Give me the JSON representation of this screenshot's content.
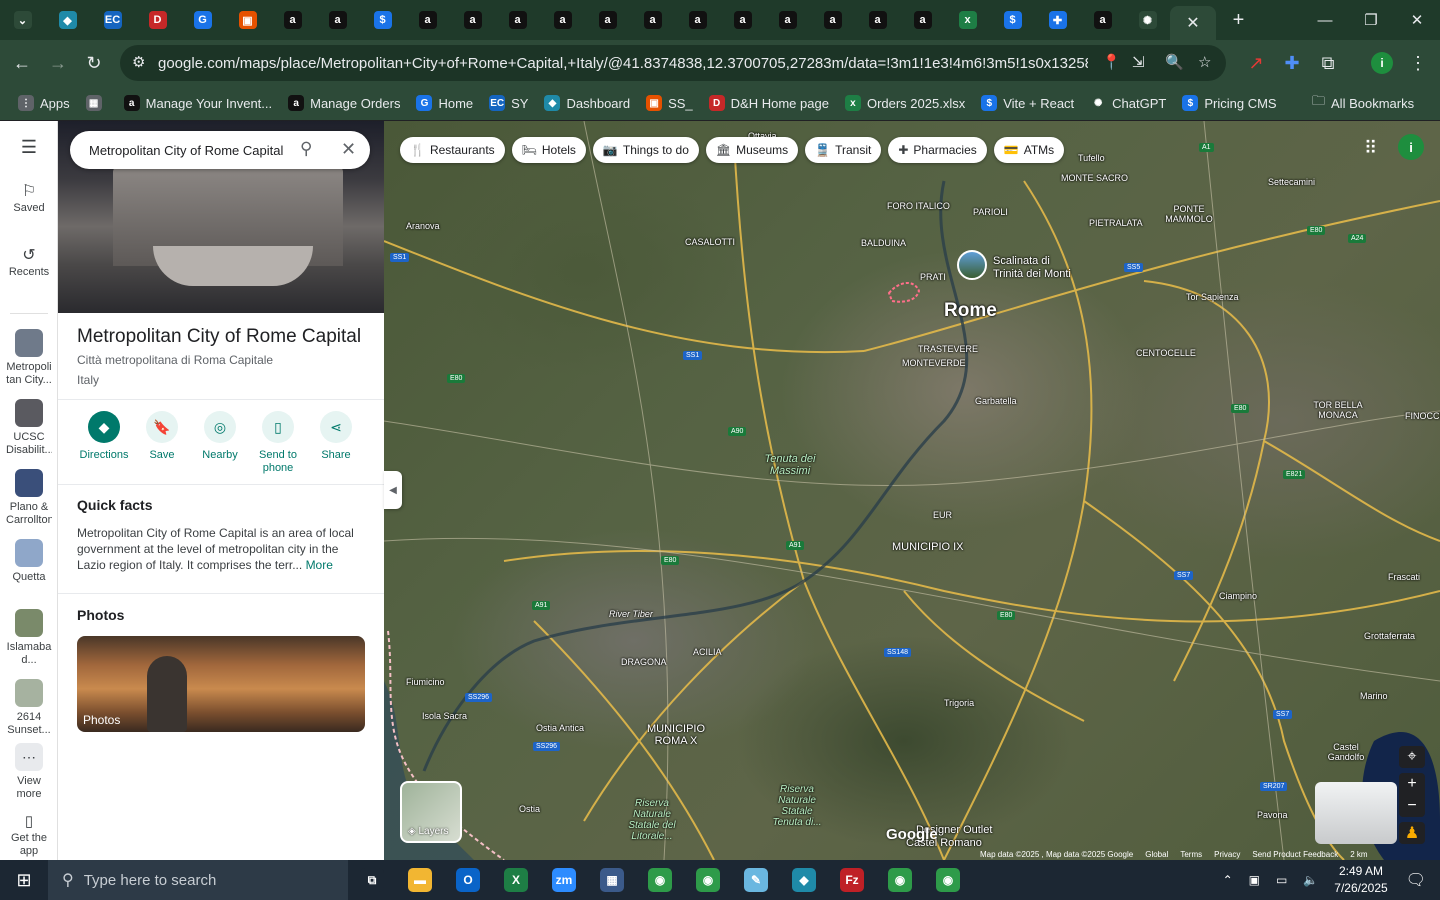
{
  "browser": {
    "tabs": [
      {
        "icon": "chevron-down-icon",
        "color": "#2d4a38",
        "glyph": "⌄"
      },
      {
        "icon": "diamond-icon",
        "color": "#1f8aa8",
        "glyph": "◆"
      },
      {
        "icon": "ec-icon",
        "color": "#1565c0",
        "glyph": "EC"
      },
      {
        "icon": "dh-icon",
        "color": "#c62828",
        "glyph": "D"
      },
      {
        "icon": "g-icon",
        "color": "#1a73e8",
        "glyph": "G"
      },
      {
        "icon": "box-icon",
        "color": "#e65100",
        "glyph": "▣"
      },
      {
        "icon": "amazon-icon",
        "color": "#111111",
        "glyph": "a"
      },
      {
        "icon": "amazon-icon",
        "color": "#111111",
        "glyph": "a"
      },
      {
        "icon": "dollar-icon",
        "color": "#1a73e8",
        "glyph": "$"
      },
      {
        "icon": "amazon-icon",
        "color": "#111111",
        "glyph": "a"
      },
      {
        "icon": "amazon-icon",
        "color": "#111111",
        "glyph": "a"
      },
      {
        "icon": "amazon-icon",
        "color": "#111111",
        "glyph": "a"
      },
      {
        "icon": "amazon-icon",
        "color": "#111111",
        "glyph": "a"
      },
      {
        "icon": "amazon-icon",
        "color": "#111111",
        "glyph": "a"
      },
      {
        "icon": "amazon-icon",
        "color": "#111111",
        "glyph": "a"
      },
      {
        "icon": "amazon-icon",
        "color": "#111111",
        "glyph": "a"
      },
      {
        "icon": "amazon-icon",
        "color": "#111111",
        "glyph": "a"
      },
      {
        "icon": "amazon-icon",
        "color": "#111111",
        "glyph": "a"
      },
      {
        "icon": "amazon-icon",
        "color": "#111111",
        "glyph": "a"
      },
      {
        "icon": "amazon-icon",
        "color": "#111111",
        "glyph": "a"
      },
      {
        "icon": "amazon-icon",
        "color": "#111111",
        "glyph": "a"
      },
      {
        "icon": "excel-icon",
        "color": "#1e7e45",
        "glyph": "x"
      },
      {
        "icon": "dollar-icon",
        "color": "#1a73e8",
        "glyph": "$"
      },
      {
        "icon": "puzzle-icon",
        "color": "#1a73e8",
        "glyph": "✚"
      },
      {
        "icon": "amazon-icon",
        "color": "#111111",
        "glyph": "a"
      },
      {
        "icon": "chatgpt-icon",
        "color": "#2d4a38",
        "glyph": "✺"
      }
    ],
    "active_tab_close": "✕",
    "new_tab": "+",
    "url": "google.com/maps/place/Metropolitan+City+of+Rome+Capital,+Italy/@41.8374838,12.3700705,27283m/data=!3m1!1e3!4m6!3m5!1s0x13258a111bd...",
    "profile_initial": "i",
    "bookmarks": [
      {
        "label": "Apps",
        "icon": "apps-icon",
        "color": "#5f6368",
        "glyph": "⋮"
      },
      {
        "label": "",
        "icon": "grid-icon",
        "color": "#5f6368",
        "glyph": "▦"
      },
      {
        "label": "Manage Your Invent...",
        "icon": "amazon-icon",
        "color": "#111111",
        "glyph": "a"
      },
      {
        "label": "Manage Orders",
        "icon": "amazon-icon",
        "color": "#111111",
        "glyph": "a"
      },
      {
        "label": "Home",
        "icon": "g-icon",
        "color": "#1a73e8",
        "glyph": "G"
      },
      {
        "label": "SY",
        "icon": "ec-icon",
        "color": "#1565c0",
        "glyph": "EC"
      },
      {
        "label": "Dashboard",
        "icon": "diamond-icon",
        "color": "#1f8aa8",
        "glyph": "◆"
      },
      {
        "label": "SS_",
        "icon": "box-icon",
        "color": "#e65100",
        "glyph": "▣"
      },
      {
        "label": "D&H Home page",
        "icon": "dh-icon",
        "color": "#c62828",
        "glyph": "D"
      },
      {
        "label": "Orders 2025.xlsx",
        "icon": "excel-icon",
        "color": "#1e7e45",
        "glyph": "x"
      },
      {
        "label": "Vite + React",
        "icon": "dollar-icon",
        "color": "#1a73e8",
        "glyph": "$"
      },
      {
        "label": "ChatGPT",
        "icon": "chatgpt-icon",
        "color": "#2d4a38",
        "glyph": "✺"
      },
      {
        "label": "Pricing CMS",
        "icon": "dollar-icon",
        "color": "#1a73e8",
        "glyph": "$"
      }
    ],
    "all_bookmarks": "All Bookmarks"
  },
  "rail": {
    "items": [
      {
        "label": "Saved",
        "glyph": "🔖"
      },
      {
        "label": "Recents",
        "glyph": "🕘"
      }
    ],
    "recents": [
      {
        "label": "Metropoli tan City...",
        "color": "#6f7a8a"
      },
      {
        "label": "UCSC Disabilit...",
        "color": "#5a5a60"
      },
      {
        "label": "Plano & Carrollton",
        "color": "#3a4f7a"
      },
      {
        "label": "Quetta",
        "color": "#8fa7c9"
      },
      {
        "label": "Islamaba d...",
        "color": "#7a8a6a"
      },
      {
        "label": "2614 Sunset...",
        "color": "#a6b2a0"
      }
    ],
    "view_more": "View more",
    "get_app": "Get the app"
  },
  "search": {
    "value": "Metropolitan City of Rome Capital"
  },
  "place": {
    "title": "Metropolitan City of Rome Capital",
    "subtitle": "Città metropolitana di Roma Capitale",
    "country": "Italy",
    "actions": [
      {
        "label": "Directions",
        "glyph": "◆",
        "name": "directions-button"
      },
      {
        "label": "Save",
        "glyph": "🔖",
        "name": "save-button"
      },
      {
        "label": "Nearby",
        "glyph": "◎",
        "name": "nearby-button"
      },
      {
        "label": "Send to phone",
        "glyph": "▯",
        "name": "send-to-phone-button"
      },
      {
        "label": "Share",
        "glyph": "⋖",
        "name": "share-button"
      }
    ],
    "quick_facts_heading": "Quick facts",
    "quick_facts_text": "Metropolitan City of Rome Capital is an area of local government at the level of metropolitan city in the Lazio region of Italy. It comprises the terr...",
    "more_link": "More",
    "photos_heading": "Photos",
    "photo_label": "Photos"
  },
  "map": {
    "chips": [
      {
        "label": "Restaurants",
        "glyph": "🍴"
      },
      {
        "label": "Hotels",
        "glyph": "🛏"
      },
      {
        "label": "Things to do",
        "glyph": "📷"
      },
      {
        "label": "Museums",
        "glyph": "🏛"
      },
      {
        "label": "Transit",
        "glyph": "🚆"
      },
      {
        "label": "Pharmacies",
        "glyph": "✚"
      },
      {
        "label": "ATMs",
        "glyph": "💳"
      }
    ],
    "labels": {
      "rome": "Rome",
      "scalinata": "Scalinata di",
      "scalinata2": "Trinità dei Monti",
      "ottavia": "Ottavia",
      "tufello": "Tufello",
      "monte_sacro": "MONTE SACRO",
      "settecamini": "Settecamini",
      "foro_italico": "FORO ITALICO",
      "parioli": "PARIOLI",
      "pietralata": "PIETRALATA",
      "ponte_mammolo": "PONTE MAMMOLO",
      "aranova": "Aranova",
      "casalotti": "CASALOTTI",
      "balduina": "BALDUINA",
      "prati": "PRATI",
      "tor_sapienza": "Tor Sapienza",
      "trastevere": "TRASTEVERE",
      "monteverde": "MONTEVERDE",
      "centocelle": "CENTOCELLE",
      "garbatella": "Garbatella",
      "tor_bella_monaca": "TOR BELLA MONACA",
      "finocchio": "FINOCCHIO",
      "tenuta": "Tenuta dei Massimi",
      "eur": "EUR",
      "municipio_ix": "MUNICIPIO IX",
      "frascati": "Frascati",
      "river_tiber": "River Tiber",
      "ciampino": "Ciampino",
      "dragona": "DRAGONA",
      "acilia": "ACILIA",
      "grottaferrata": "Grottaferrata",
      "fiumicino": "Fiumicino",
      "isola_sacra": "Isola Sacra",
      "ostia_antica": "Ostia Antica",
      "municipio_x": "MUNICIPIO ROMA X",
      "trigoria": "Trigoria",
      "marino": "Marino",
      "castel_gandolfo": "Castel Gandolfo",
      "ostia": "Ostia",
      "riserva1": "Riserva Naturale Statale del Litorale...",
      "riserva2": "Riserva Naturale Statale Tenuta di...",
      "designer_outlet": "Designer Outlet",
      "castel_romano": "Castel Romano",
      "pavona": "Pavona"
    },
    "road_shields": [
      {
        "text": "SS1",
        "blue": true
      },
      {
        "text": "E80",
        "blue": false
      },
      {
        "text": "SS1",
        "blue": true
      },
      {
        "text": "A90",
        "blue": false
      },
      {
        "text": "A91",
        "blue": false
      },
      {
        "text": "E80",
        "blue": false
      },
      {
        "text": "A91",
        "blue": false
      },
      {
        "text": "SS296",
        "blue": true
      },
      {
        "text": "SS296",
        "blue": true
      },
      {
        "text": "SS148",
        "blue": true
      },
      {
        "text": "E80",
        "blue": false
      },
      {
        "text": "SS7",
        "blue": true
      },
      {
        "text": "SS7",
        "blue": true
      },
      {
        "text": "SR207",
        "blue": true
      },
      {
        "text": "E80",
        "blue": false
      },
      {
        "text": "E821",
        "blue": false
      },
      {
        "text": "SS5",
        "blue": true
      },
      {
        "text": "A24",
        "blue": false
      },
      {
        "text": "E80",
        "blue": false
      },
      {
        "text": "A1",
        "blue": false
      }
    ],
    "layers_label": "Layers",
    "google_logo": "Google",
    "attribution": [
      "Map data ©2025 , Map data ©2025 Google",
      "Global",
      "Terms",
      "Privacy",
      "Send Product Feedback",
      "2 km"
    ],
    "avatar_initial": "i"
  },
  "taskbar": {
    "search_placeholder": "Type here to search",
    "apps": [
      {
        "icon": "task-view-icon",
        "color": "#1c2733",
        "glyph": "⧉"
      },
      {
        "icon": "file-explorer-icon",
        "color": "#f2b632",
        "glyph": "▬"
      },
      {
        "icon": "outlook-icon",
        "color": "#0a64c8",
        "glyph": "O"
      },
      {
        "icon": "excel-icon",
        "color": "#1e7e45",
        "glyph": "X"
      },
      {
        "icon": "zoom-icon",
        "color": "#2d8cff",
        "glyph": "zm"
      },
      {
        "icon": "calculator-icon",
        "color": "#3b5a8a",
        "glyph": "▦"
      },
      {
        "icon": "chrome-icon",
        "color": "#2e9b49",
        "glyph": "◉"
      },
      {
        "icon": "chrome-icon",
        "color": "#2e9b49",
        "glyph": "◉"
      },
      {
        "icon": "notepad-icon",
        "color": "#6ab7e0",
        "glyph": "✎"
      },
      {
        "icon": "diamond-icon",
        "color": "#1f8aa8",
        "glyph": "◆"
      },
      {
        "icon": "filezilla-icon",
        "color": "#bf2026",
        "glyph": "Fz"
      },
      {
        "icon": "chrome-icon",
        "color": "#2e9b49",
        "glyph": "◉"
      },
      {
        "icon": "chrome-icon",
        "color": "#2e9b49",
        "glyph": "◉"
      }
    ],
    "time": "2:49 AM",
    "date": "7/26/2025"
  }
}
